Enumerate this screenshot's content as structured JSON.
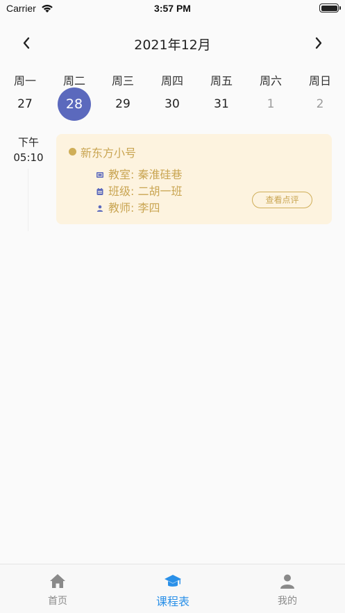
{
  "status_bar": {
    "carrier": "Carrier",
    "time": "3:57 PM",
    "battery_level": 1.0
  },
  "calendar": {
    "month_title": "2021年12月",
    "prev_icon": "chevron-left-icon",
    "next_icon": "chevron-right-icon",
    "days": [
      {
        "name": "周一",
        "num": "27"
      },
      {
        "name": "周二",
        "num": "28"
      },
      {
        "name": "周三",
        "num": "29"
      },
      {
        "name": "周四",
        "num": "30"
      },
      {
        "name": "周五",
        "num": "31"
      },
      {
        "name": "周六",
        "num": "1"
      },
      {
        "name": "周日",
        "num": "2"
      }
    ],
    "selected_day": "28",
    "selected_color": "#5b69bd"
  },
  "schedule": {
    "time_period": "下午",
    "time": "05:10",
    "course": {
      "name": "新东方小号",
      "classroom": "教室: 秦淮硅巷",
      "class_name": "班级:  二胡一班",
      "teacher": "教师:  李四",
      "review_button": "查看点评",
      "card_color": "#fdf3df",
      "accent_color": "#c9a552",
      "info_icon_color": "#5b69bd"
    }
  },
  "tab_bar": {
    "tabs": [
      {
        "label": "首页",
        "icon": "home-icon",
        "active": false
      },
      {
        "label": "课程表",
        "icon": "graduation-cap-icon",
        "active": true
      },
      {
        "label": "我的",
        "icon": "person-icon",
        "active": false
      }
    ],
    "active_color": "#2a90e8",
    "inactive_color": "#8a8a8a"
  }
}
